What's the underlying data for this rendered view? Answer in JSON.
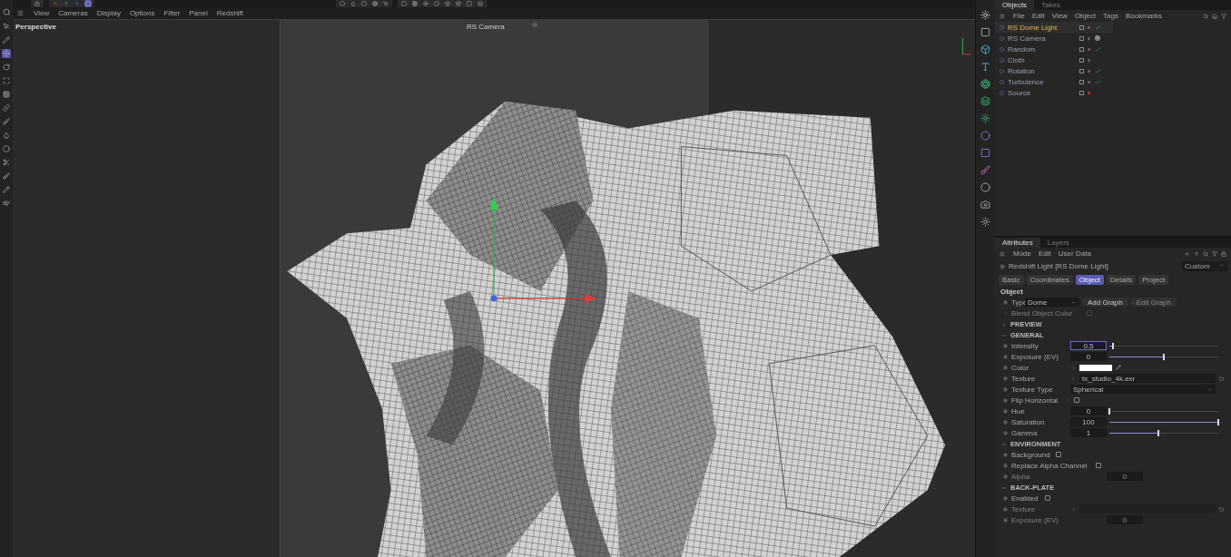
{
  "viewport": {
    "menu": [
      "View",
      "Cameras",
      "Display",
      "Options",
      "Filter",
      "Panel",
      "Redshift"
    ],
    "view_name": "Perspective",
    "camera": "RS Camera"
  },
  "object_manager": {
    "tabs": [
      {
        "label": "Objects",
        "selected": true
      },
      {
        "label": "Takes",
        "selected": false
      }
    ],
    "menu": [
      "File",
      "Edit",
      "View",
      "Object",
      "Tags",
      "Bookmarks"
    ],
    "objects": [
      {
        "name": "RS Dome Light",
        "selected": true,
        "kind": "check"
      },
      {
        "name": "RS Camera",
        "selected": false,
        "kind": "camera"
      },
      {
        "name": "Random",
        "selected": false,
        "kind": "check"
      },
      {
        "name": "Cloth",
        "selected": false,
        "kind": "plain"
      },
      {
        "name": "Rotation",
        "selected": false,
        "kind": "check"
      },
      {
        "name": "Turbulence",
        "selected": false,
        "kind": "check"
      },
      {
        "name": "Source",
        "selected": false,
        "kind": "red"
      }
    ]
  },
  "attributes": {
    "tabs": [
      {
        "label": "Attributes",
        "selected": true
      },
      {
        "label": "Layers",
        "selected": false
      }
    ],
    "menu": [
      "Mode",
      "Edit",
      "User Data"
    ],
    "title": "Redshift Light [RS Dome Light]",
    "preset": "Custom",
    "subtabs": [
      {
        "label": "Basic",
        "selected": false
      },
      {
        "label": "Coordinates",
        "selected": false
      },
      {
        "label": "Object",
        "selected": true
      },
      {
        "label": "Details",
        "selected": false
      },
      {
        "label": "Project",
        "selected": false
      }
    ],
    "section": "Object",
    "type": {
      "label": "Type",
      "value": "Dome",
      "add_button": "Add Graph",
      "edit_button": "Edit Graph"
    },
    "blend": {
      "label": "Blend Object Color",
      "checked": false,
      "disabled": true
    },
    "groups": [
      {
        "title": "PREVIEW",
        "expanded": false
      },
      {
        "title": "GENERAL",
        "expanded": true,
        "params": [
          {
            "kind": "slider",
            "label": "Intensity",
            "value": "0.5",
            "level": 0.03,
            "focused": true
          },
          {
            "kind": "slider",
            "label": "Exposure (EV)",
            "value": "0",
            "level": 0.5,
            "focused": false
          },
          {
            "kind": "color",
            "label": "Color",
            "color": "#ffffff"
          },
          {
            "kind": "file",
            "label": "Texture",
            "value": "tx_studio_4k.exr",
            "disabled": false
          },
          {
            "kind": "dropdown",
            "label": "Texture Type",
            "value": "Spherical"
          },
          {
            "kind": "checkbox",
            "label": "Flip Horizontal",
            "checked": false,
            "disabled": false
          },
          {
            "kind": "slider",
            "label": "Hue",
            "value": "0",
            "level": 0.0,
            "focused": false
          },
          {
            "kind": "slider",
            "label": "Saturation",
            "value": "100",
            "level": 1.0,
            "focused": false
          },
          {
            "kind": "slider",
            "label": "Gamma",
            "value": "1",
            "level": 0.45,
            "focused": false
          }
        ]
      },
      {
        "title": "ENVIRONMENT",
        "expanded": true,
        "params": [
          {
            "kind": "checkbox",
            "label": "Background",
            "checked": false,
            "disabled": false
          },
          {
            "kind": "checkbox",
            "label": "Replace Alpha Channel",
            "checked": false,
            "disabled": false
          },
          {
            "kind": "number",
            "label": "Alpha",
            "value": "0",
            "disabled": true
          }
        ]
      },
      {
        "title": "BACK-PLATE",
        "expanded": true,
        "params": [
          {
            "kind": "checkbox",
            "label": "Enabled",
            "checked": false,
            "disabled": false
          },
          {
            "kind": "file",
            "label": "Texture",
            "disabled": true
          },
          {
            "kind": "number",
            "label": "Exposure (EV)",
            "value": "0",
            "disabled": true
          }
        ]
      }
    ]
  }
}
